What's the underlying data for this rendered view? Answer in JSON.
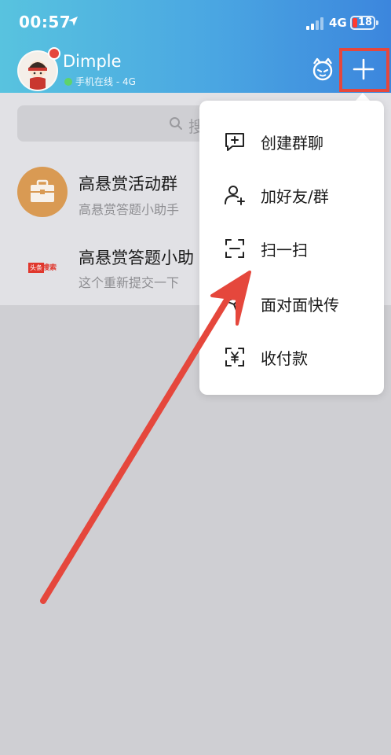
{
  "status_bar": {
    "time": "00:57",
    "network": "4G",
    "battery": "18",
    "icons": [
      "location-arrow-icon",
      "signal-icon",
      "battery-icon"
    ]
  },
  "header": {
    "username": "Dimple",
    "status": "手机在线 - 4G",
    "icons": [
      "avatar",
      "pet-icon",
      "plus-icon"
    ]
  },
  "search": {
    "placeholder": "搜"
  },
  "chats": [
    {
      "title": "高悬赏活动群",
      "preview": "高悬赏答题小助手"
    },
    {
      "title": "高悬赏答题小助",
      "preview": "这个重新提交一下"
    }
  ],
  "chat_logo": {
    "tag": "头条",
    "text": "搜索"
  },
  "menu": {
    "items": [
      {
        "label": "创建群聊",
        "icon": "create-group-icon"
      },
      {
        "label": "加好友/群",
        "icon": "add-friend-icon"
      },
      {
        "label": "扫一扫",
        "icon": "scan-icon"
      },
      {
        "label": "面对面快传",
        "icon": "transfer-icon"
      },
      {
        "label": "收付款",
        "icon": "payment-icon"
      }
    ]
  },
  "colors": {
    "header_start": "#58c3df",
    "header_end": "#3c86dd",
    "highlight": "#e5473c",
    "arrow": "#e5473c",
    "online": "#5ed36a"
  }
}
